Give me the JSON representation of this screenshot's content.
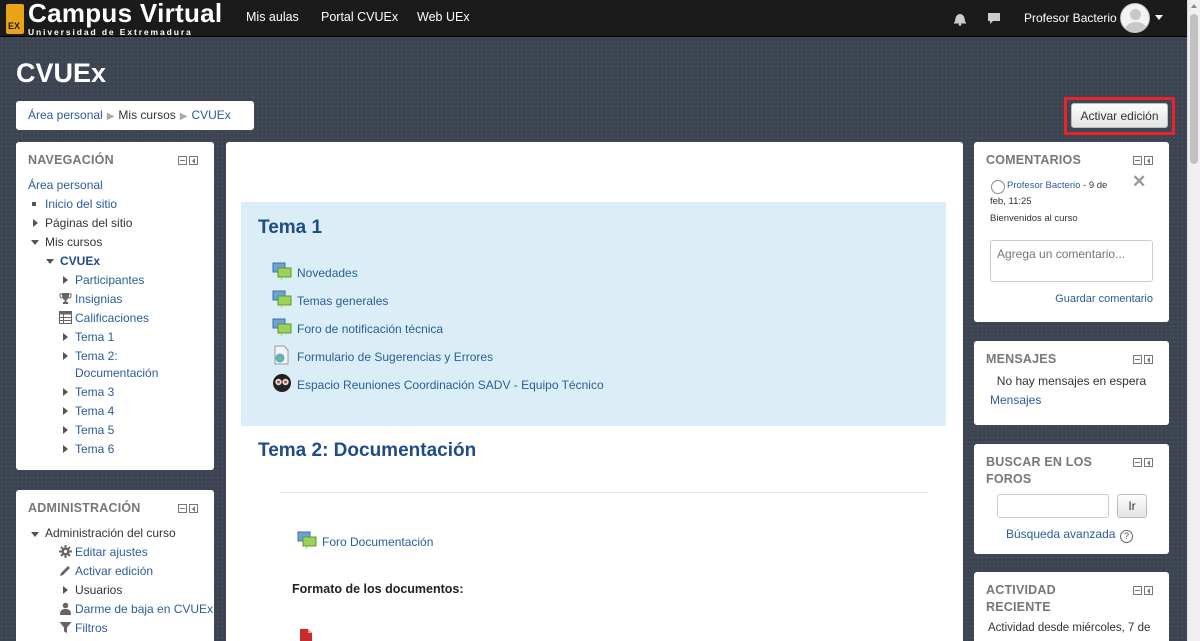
{
  "navbar": {
    "logo_title": "Campus Virtual",
    "logo_subtitle": "Universidad de Extremadura",
    "logo_mark": "EX",
    "links": [
      "Mis aulas",
      "Portal CVUEx",
      "Web UEx"
    ],
    "user_name": "Profesor Bacterio"
  },
  "page": {
    "title": "CVUEx",
    "breadcrumb": [
      "Área personal",
      "Mis cursos",
      "CVUEx"
    ],
    "edit_button": "Activar edición"
  },
  "navigation": {
    "title": "NAVEGACIÓN",
    "items": [
      "Área personal",
      "Inicio del sitio",
      "Páginas del sitio",
      "Mis cursos",
      "CVUEx",
      "Participantes",
      "Insignias",
      "Calificaciones",
      "Tema 1",
      "Tema 2: Documentación",
      "Tema 3",
      "Tema 4",
      "Tema 5",
      "Tema 6"
    ]
  },
  "administration": {
    "title": "ADMINISTRACIÓN",
    "items": [
      "Administración del curso",
      "Editar ajustes",
      "Activar edición",
      "Usuarios",
      "Darme de baja en CVUEx",
      "Filtros"
    ]
  },
  "main": {
    "sections": [
      {
        "title": "Tema 1",
        "activities": [
          {
            "label": "Novedades",
            "icon": "forum-icon"
          },
          {
            "label": "Temas generales",
            "icon": "forum-icon"
          },
          {
            "label": "Foro de notificación técnica",
            "icon": "forum-icon"
          },
          {
            "label": "Formulario de Sugerencias y Errores",
            "icon": "feedback-icon"
          },
          {
            "label": "Espacio Reuniones Coordinación SADV - Equipo Técnico",
            "icon": "videoconference-icon"
          }
        ]
      },
      {
        "title": "Tema 2: Documentación",
        "activities": [
          {
            "label": "Foro Documentación",
            "icon": "forum-icon"
          }
        ],
        "label": "Formato de los documentos:"
      }
    ]
  },
  "comments": {
    "title": "COMENTARIOS",
    "author": "Profesor Bacterio",
    "date_part1": " - 9 de",
    "date_part2": "feb, 11:25",
    "text": "Bienvenidos al curso",
    "placeholder": "Agrega un comentario...",
    "save": "Guardar comentario"
  },
  "messages": {
    "title": "MENSAJES",
    "empty": "No hay mensajes en espera",
    "link": "Mensajes"
  },
  "forum_search": {
    "title_line1": "BUSCAR EN LOS",
    "title_line2": "FOROS",
    "go": "Ir",
    "advanced": "Búsqueda avanzada"
  },
  "recent_activity": {
    "title_line1": "ACTIVIDAD",
    "title_line2": "RECIENTE",
    "text": "Actividad desde miércoles, 7 de"
  }
}
